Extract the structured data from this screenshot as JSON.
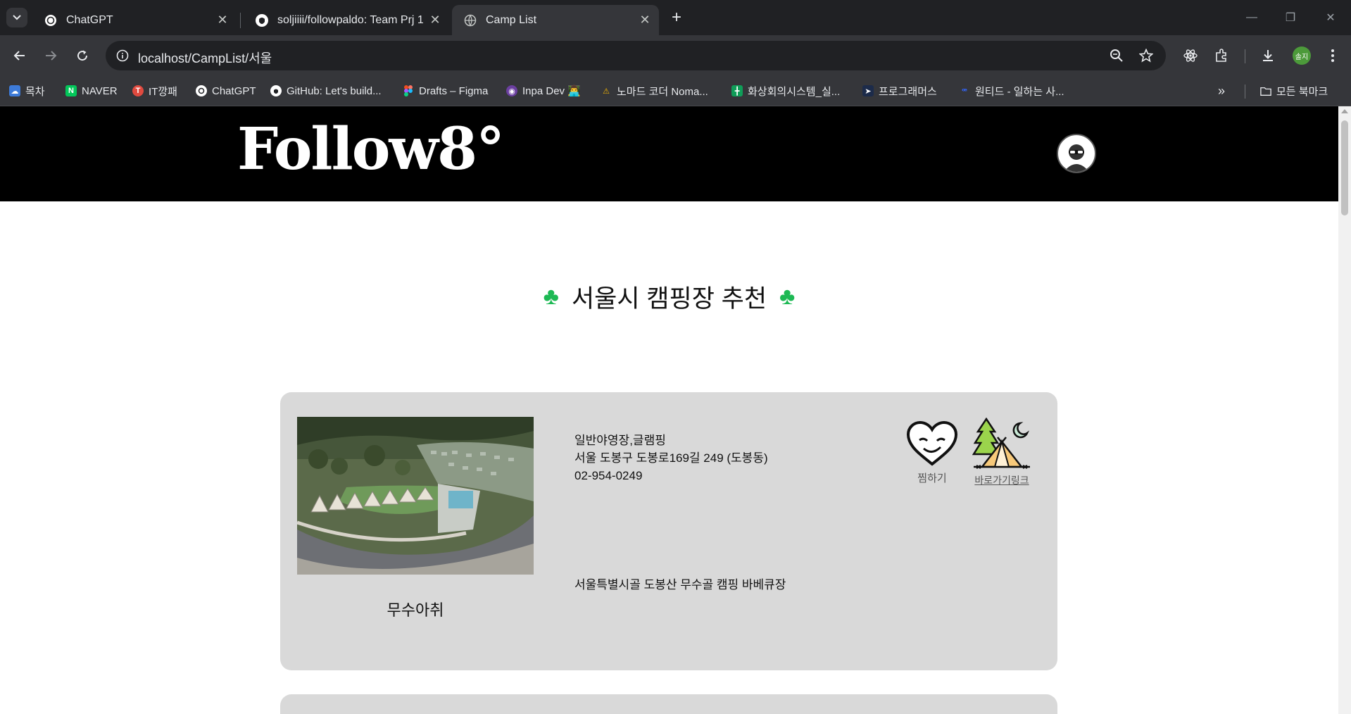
{
  "browser": {
    "tabs": [
      {
        "title": "ChatGPT",
        "icon": "chatgpt-icon"
      },
      {
        "title": "soljiiii/followpaldo: Team Prj 1",
        "icon": "github-icon"
      },
      {
        "title": "Camp List",
        "icon": "globe-icon"
      }
    ],
    "url": "localhost/CampList/서울",
    "profile_label": "솔지",
    "bookmarks": [
      {
        "label": "목차"
      },
      {
        "label": "NAVER"
      },
      {
        "label": "IT깡패"
      },
      {
        "label": "ChatGPT"
      },
      {
        "label": "GitHub: Let's build..."
      },
      {
        "label": "Drafts – Figma"
      },
      {
        "label": "Inpa Dev 👨‍💻"
      },
      {
        "label": "노마드 코더 Noma..."
      },
      {
        "label": "화상회의시스템_실..."
      },
      {
        "label": "프로그래머스"
      },
      {
        "label": "원티드 - 일하는 사..."
      }
    ],
    "all_bookmarks": "모든 북마크"
  },
  "site": {
    "logo": "Follow8°",
    "page_title": "서울시 캠핑장 추천"
  },
  "camps": [
    {
      "name": "무수아취",
      "type": "일반야영장,글램핑",
      "address": "서울 도봉구 도봉로169길 249 (도봉동)",
      "phone": "02-954-0249",
      "description": "서울특별시골 도봉산 무수골 캠핑 바베큐장",
      "wish_label": "찜하기",
      "link_label": "바로가기링크"
    }
  ],
  "colors": {
    "header_bg": "#000000",
    "card_bg": "#d9d9d9",
    "clover": "#1db954"
  }
}
